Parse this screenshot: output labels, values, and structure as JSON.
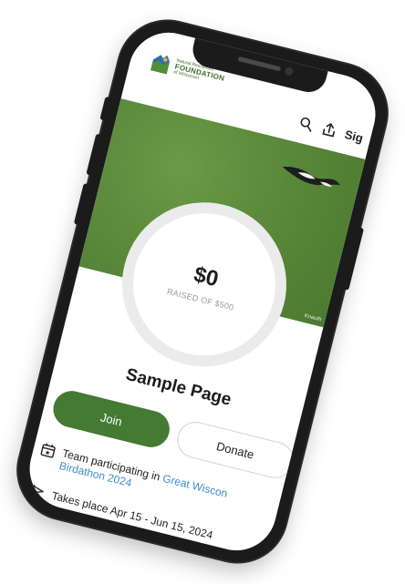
{
  "org": {
    "small_text": "Natural Resources",
    "name": "FOUNDATION",
    "sub_text": "of Wisconsin"
  },
  "header": {
    "signin_label": "Sig"
  },
  "hero": {
    "credit": "Knauth"
  },
  "fundraising": {
    "amount": "$0",
    "raised_label": "RAISED OF $500",
    "progress_fraction": 0
  },
  "page": {
    "title": "Sample Page"
  },
  "actions": {
    "join_label": "Join",
    "donate_label": "Donate"
  },
  "team": {
    "prefix": "Team participating in",
    "event_link": "Great Wiscon",
    "event_link_line2": "Birdathon 2024"
  },
  "dates": {
    "text": "Takes place Apr 15 - Jun 15, 2024"
  },
  "colors": {
    "brand_green": "#447a32",
    "link_blue": "#3f8fc9"
  },
  "icons": [
    "logo-mark-icon",
    "search-icon",
    "share-icon",
    "bird-icon",
    "calendar-icon",
    "flag-icon"
  ]
}
